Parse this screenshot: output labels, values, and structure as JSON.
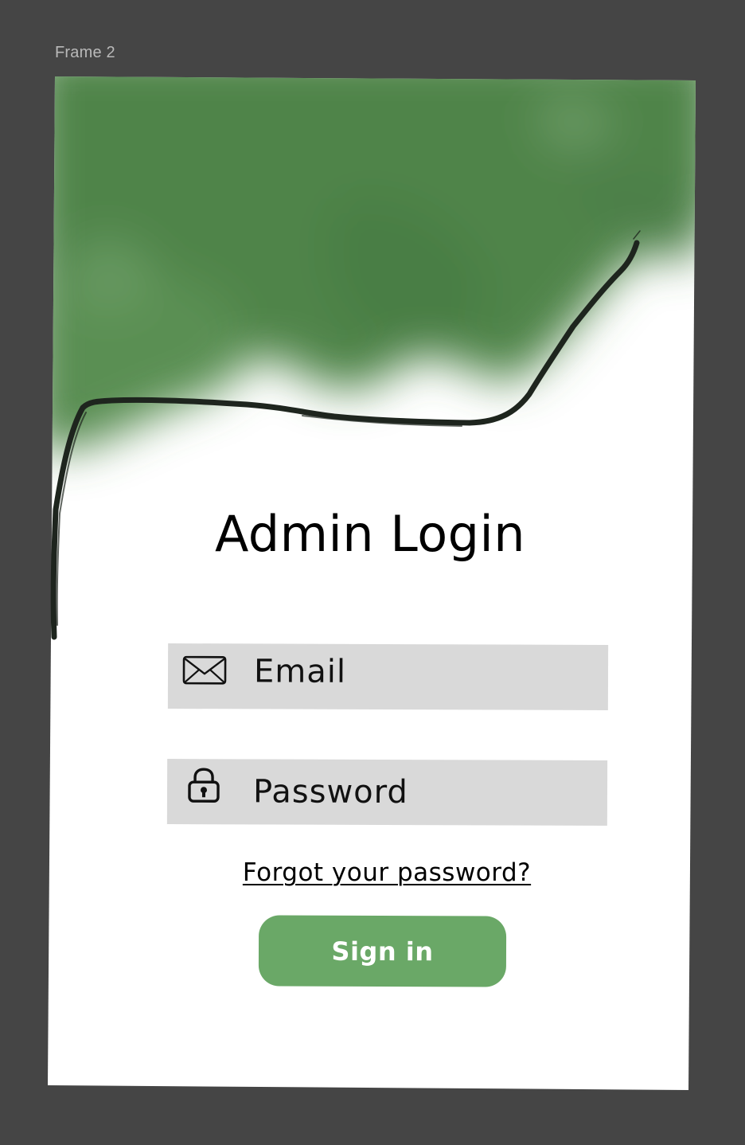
{
  "canvas": {
    "frame_label": "Frame 2"
  },
  "login": {
    "title": "Admin Login",
    "email": {
      "placeholder": "Email",
      "icon": "envelope-icon"
    },
    "password": {
      "placeholder": "Password",
      "icon": "padlock-icon"
    },
    "forgot_link": "Forgot your password?",
    "signin_label": "Sign in"
  },
  "colors": {
    "canvas_bg": "#454545",
    "frame_bg": "#ffffff",
    "foliage_green": "#4e8048",
    "field_bg": "#d9d9d9",
    "button_bg": "#6aa867",
    "button_text": "#ffffff"
  }
}
